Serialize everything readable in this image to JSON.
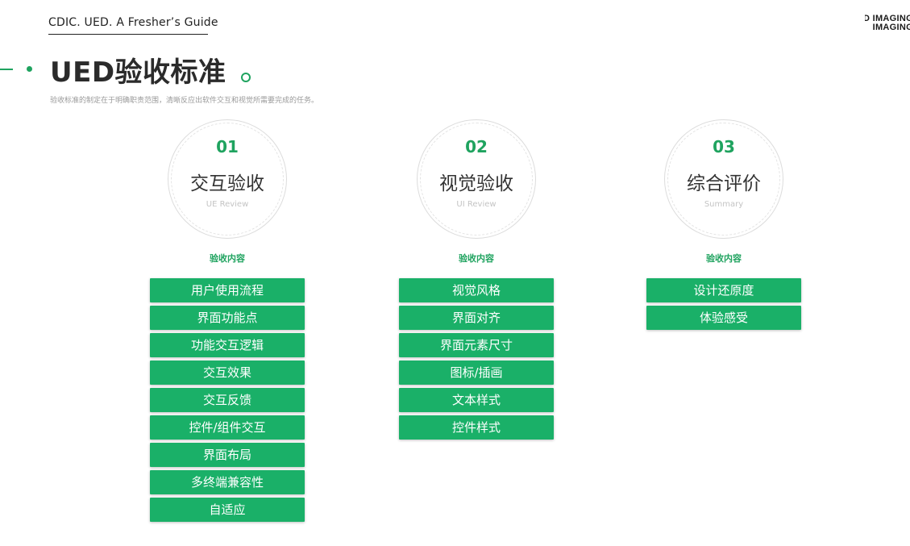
{
  "header": {
    "guide_title": "CDIC. UED.  A Fresher’s Guide",
    "logo_line_1": "UNITED IMAGING",
    "logo_line_2": "IMAGING"
  },
  "page": {
    "title": "UED验收标准",
    "subtitle": "验收标准的制定在于明确职责范围，清晰反应出软件交互和视觉所需要完成的任务。"
  },
  "colors": {
    "accent": "#1fa35f",
    "item_background": "#1ab068"
  },
  "columns": [
    {
      "number": "01",
      "label": "交互验收",
      "sub": "UE Review",
      "section_label": "验收内容",
      "items": [
        "用户使用流程",
        "界面功能点",
        "功能交互逻辑",
        "交互效果",
        "交互反馈",
        "控件/组件交互",
        "界面布局",
        "多终端兼容性",
        "自适应"
      ]
    },
    {
      "number": "02",
      "label": "视觉验收",
      "sub": "UI Review",
      "section_label": "验收内容",
      "items": [
        "视觉风格",
        "界面对齐",
        "界面元素尺寸",
        "图标/插画",
        "文本样式",
        "控件样式"
      ]
    },
    {
      "number": "03",
      "label": "综合评价",
      "sub": "Summary",
      "section_label": "验收内容",
      "items": [
        "设计还原度",
        "体验感受"
      ]
    }
  ]
}
